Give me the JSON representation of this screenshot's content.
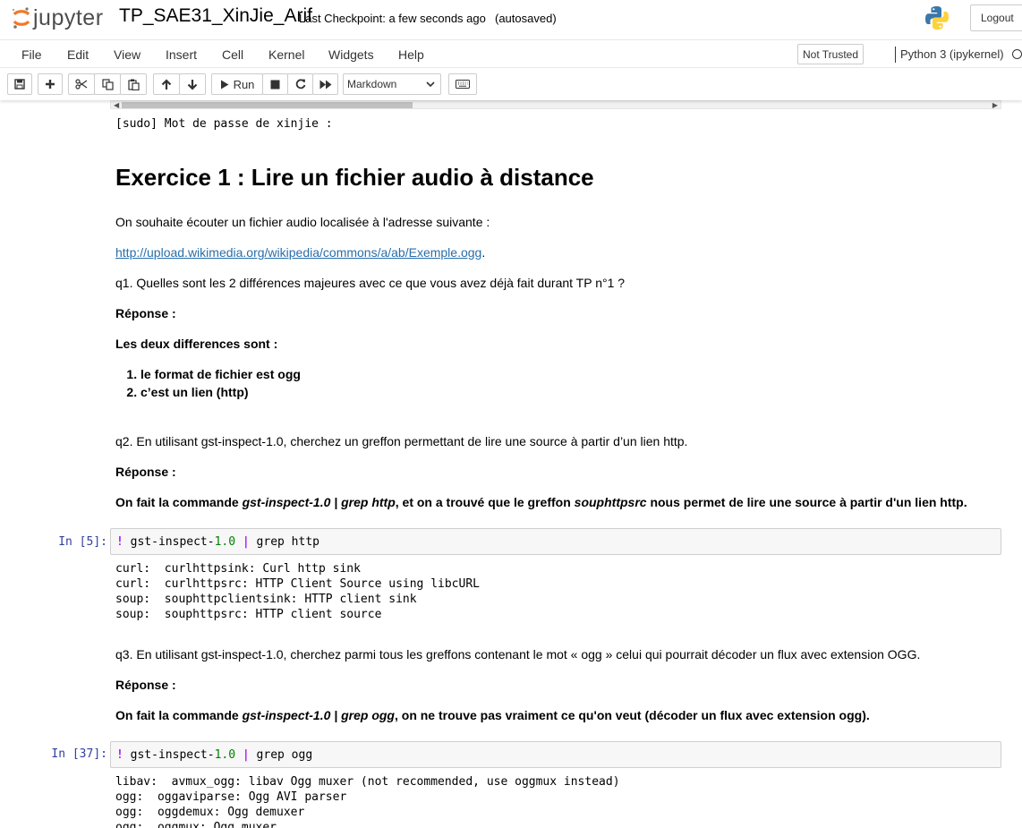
{
  "header": {
    "logo_text": "jupyter",
    "notebook_name": "TP_SAE31_XinJie_Arif",
    "checkpoint": "Last Checkpoint: a few seconds ago",
    "autosave": "(autosaved)",
    "logout_label": "Logout",
    "icons": {
      "logo": "jupyter-logo-icon",
      "kernel_logo": "python-logo-icon"
    }
  },
  "menubar": {
    "items": [
      "File",
      "Edit",
      "View",
      "Insert",
      "Cell",
      "Kernel",
      "Widgets",
      "Help"
    ],
    "not_trusted": "Not Trusted",
    "kernel_name": "Python 3 (ipykernel)"
  },
  "toolbar": {
    "run_label": "Run",
    "cell_type": "Markdown",
    "icons": [
      "save-icon",
      "plus-icon",
      "scissors-icon",
      "copy-icon",
      "paste-icon",
      "arrow-up-icon",
      "arrow-down-icon",
      "play-icon",
      "stop-icon",
      "restart-icon",
      "fast-forward-icon",
      "keyboard-icon"
    ]
  },
  "notebook": {
    "sudo_output": "[sudo] Mot de passe de xinjie :",
    "heading": "Exercice 1 : Lire un fichier audio à distance",
    "p_intro": "On souhaite écouter un fichier audio localisée à l'adresse suivante :",
    "link": "http://upload.wikimedia.org/wikipedia/commons/a/ab/Exemple.ogg",
    "link_suffix": ".",
    "q1": "q1. Quelles sont les 2 différences majeures avec ce que vous avez déjà fait durant TP n°1 ?",
    "reponse_label": "Réponse :",
    "diff_title": "Les deux differences sont :",
    "diff_items": [
      "le format de fichier est ogg",
      "c’est un lien (http)"
    ],
    "q2": "q2. En utilisant gst-inspect-1.0, cherchez un greffon permettant de lire une source à partir d’un lien http.",
    "ans2": {
      "a": "On fait la commande ",
      "b": "gst-inspect-1.0 | grep http",
      "c": ", et on a trouvé que le greffon ",
      "d": "souphttpsrc",
      "e": " nous permet de lire une source à partir d'un lien http."
    },
    "cell1": {
      "prompt": "In [5]:",
      "code": {
        "bang": "!",
        "cmd": " gst-inspect-",
        "num": "1.0",
        "pipe": "|",
        "rest": " grep http"
      },
      "output": "curl:  curlhttpsink: Curl http sink\ncurl:  curlhttpsrc: HTTP Client Source using libcURL\nsoup:  souphttpclientsink: HTTP client sink\nsoup:  souphttpsrc: HTTP client source"
    },
    "q3": "q3. En utilisant gst-inspect-1.0, cherchez parmi tous les greffons contenant le mot « ogg » celui qui pourrait décoder un flux avec extension OGG.",
    "ans3": {
      "a": "On fait la commande ",
      "b": "gst-inspect-1.0 | grep ogg",
      "c": ", on ne trouve pas vraiment ce qu'on veut (décoder un flux avec extension ogg)."
    },
    "cell2": {
      "prompt": "In [37]:",
      "code": {
        "bang": "!",
        "cmd": " gst-inspect-",
        "num": "1.0",
        "pipe": "|",
        "rest": " grep ogg"
      },
      "output": "libav:  avmux_ogg: libav Ogg muxer (not recommended, use oggmux instead)\nogg:  oggaviparse: Ogg AVI parser\nogg:  oggdemux: Ogg demuxer\nogg:  oggmux: Ogg muxer"
    }
  }
}
